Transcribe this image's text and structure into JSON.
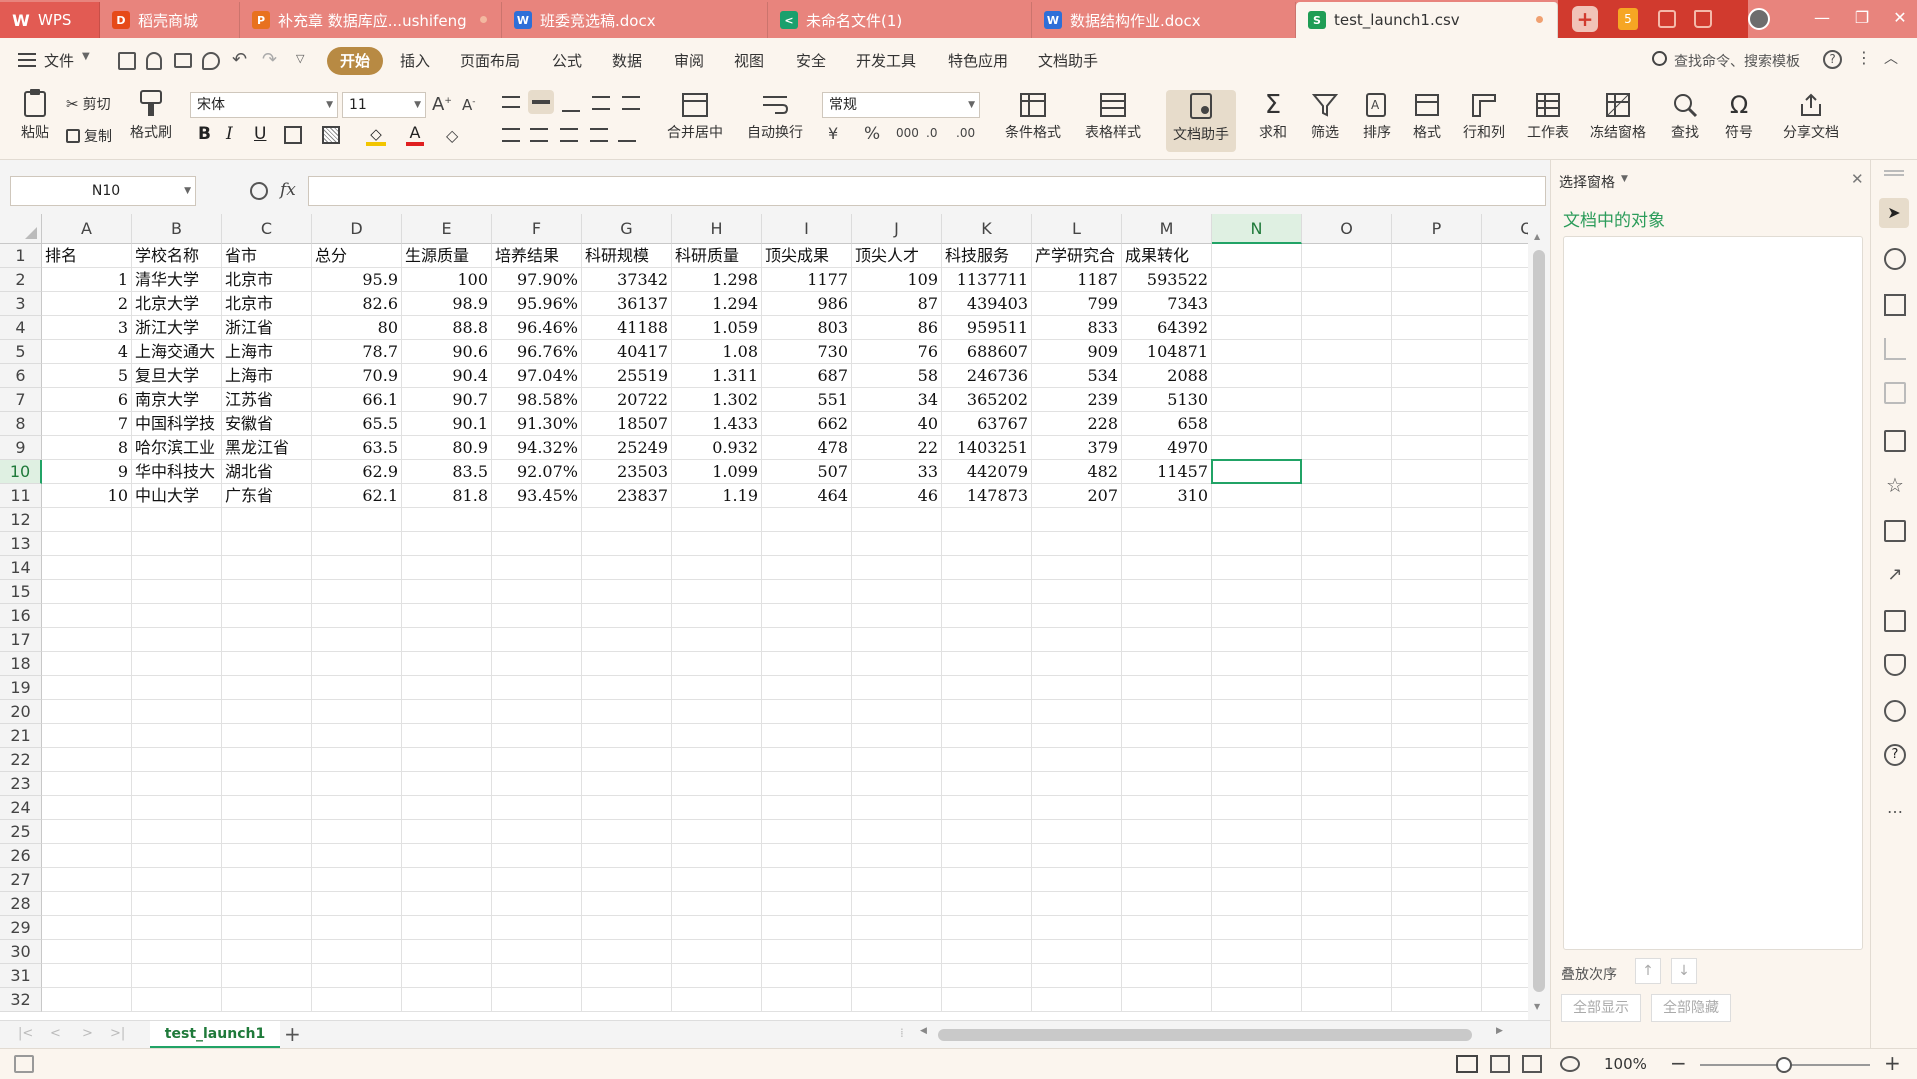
{
  "tabs": [
    {
      "label": "WPS",
      "icon": "wps-logo-icon",
      "color": "#d9534f"
    },
    {
      "label": "稻壳商城",
      "icon": "docer-icon",
      "color": "#e64a19"
    },
    {
      "label": "补充章 数据库应...ushifeng",
      "icon": "ppt-icon",
      "color": "#e8711f"
    },
    {
      "label": "班委竞选稿.docx",
      "icon": "word-doc-icon",
      "color": "#2f6fd8"
    },
    {
      "label": "未命名文件(1)",
      "icon": "flowchart-icon",
      "color": "#1aa06d"
    },
    {
      "label": "数据结构作业.docx",
      "icon": "word-doc-icon",
      "color": "#2f6fd8"
    },
    {
      "label": "test_launch1.csv",
      "icon": "spreadsheet-icon",
      "color": "#1f9d55"
    }
  ],
  "menu": {
    "file": "文件",
    "items": [
      "开始",
      "插入",
      "页面布局",
      "公式",
      "数据",
      "审阅",
      "视图",
      "安全",
      "开发工具",
      "特色应用",
      "文档助手"
    ],
    "search": "查找命令、搜索模板"
  },
  "ribbon": {
    "paste": "粘贴",
    "cut": "剪切",
    "copy": "复制",
    "format_painter": "格式刷",
    "font_name": "宋体",
    "font_size": "11",
    "bold": "B",
    "italic": "I",
    "underline": "U",
    "merge_center": "合并居中",
    "wrap_text": "自动换行",
    "number_format": "常规",
    "conditional_format": "条件格式",
    "table_style": "表格样式",
    "doc_assistant": "文档助手",
    "sum": "求和",
    "filter": "筛选",
    "sort": "排序",
    "format": "格式",
    "row_col": "行和列",
    "worksheet": "工作表",
    "freeze": "冻结窗格",
    "find": "查找",
    "symbol": "符号",
    "share": "分享文档"
  },
  "formula_bar": {
    "name_box": "N10",
    "fx": "fx",
    "content": ""
  },
  "sheet": {
    "columns": [
      "A",
      "B",
      "C",
      "D",
      "E",
      "F",
      "G",
      "H",
      "I",
      "J",
      "K",
      "L",
      "M",
      "N",
      "O",
      "P",
      "Q"
    ],
    "selected_column": "N",
    "selected_row": "10",
    "rows": [
      [
        "排名",
        "学校名称",
        "省市",
        "总分",
        "生源质量",
        "培养结果",
        "科研规模",
        "科研质量",
        "顶尖成果",
        "顶尖人才",
        "科技服务",
        "产学研究合",
        "成果转化"
      ],
      [
        "1",
        "清华大学",
        "北京市",
        "95.9",
        "100",
        "97.90%",
        "37342",
        "1.298",
        "1177",
        "109",
        "1137711",
        "1187",
        "593522"
      ],
      [
        "2",
        "北京大学",
        "北京市",
        "82.6",
        "98.9",
        "95.96%",
        "36137",
        "1.294",
        "986",
        "87",
        "439403",
        "799",
        "7343"
      ],
      [
        "3",
        "浙江大学",
        "浙江省",
        "80",
        "88.8",
        "96.46%",
        "41188",
        "1.059",
        "803",
        "86",
        "959511",
        "833",
        "64392"
      ],
      [
        "4",
        "上海交通大",
        "上海市",
        "78.7",
        "90.6",
        "96.76%",
        "40417",
        "1.08",
        "730",
        "76",
        "688607",
        "909",
        "104871"
      ],
      [
        "5",
        "复旦大学",
        "上海市",
        "70.9",
        "90.4",
        "97.04%",
        "25519",
        "1.311",
        "687",
        "58",
        "246736",
        "534",
        "2088"
      ],
      [
        "6",
        "南京大学",
        "江苏省",
        "66.1",
        "90.7",
        "98.58%",
        "20722",
        "1.302",
        "551",
        "34",
        "365202",
        "239",
        "5130"
      ],
      [
        "7",
        "中国科学技",
        "安徽省",
        "65.5",
        "90.1",
        "91.30%",
        "18507",
        "1.433",
        "662",
        "40",
        "63767",
        "228",
        "658"
      ],
      [
        "8",
        "哈尔滨工业",
        "黑龙江省",
        "63.5",
        "80.9",
        "94.32%",
        "25249",
        "0.932",
        "478",
        "22",
        "1403251",
        "379",
        "4970"
      ],
      [
        "9",
        "华中科技大",
        "湖北省",
        "62.9",
        "83.5",
        "92.07%",
        "23503",
        "1.099",
        "507",
        "33",
        "442079",
        "482",
        "11457"
      ],
      [
        "10",
        "中山大学",
        "广东省",
        "62.1",
        "81.8",
        "93.45%",
        "23837",
        "1.19",
        "464",
        "46",
        "147873",
        "207",
        "310"
      ]
    ],
    "tab_name": "test_launch1"
  },
  "panel": {
    "title": "选择窗格",
    "subtitle": "文档中的对象",
    "stack_order": "叠放次序",
    "show_all": "全部显示",
    "hide_all": "全部隐藏"
  },
  "status": {
    "zoom": "100%"
  },
  "colors": {
    "accent": "#21a366",
    "tabbar": "#e8847d",
    "start": "#b88a43"
  }
}
